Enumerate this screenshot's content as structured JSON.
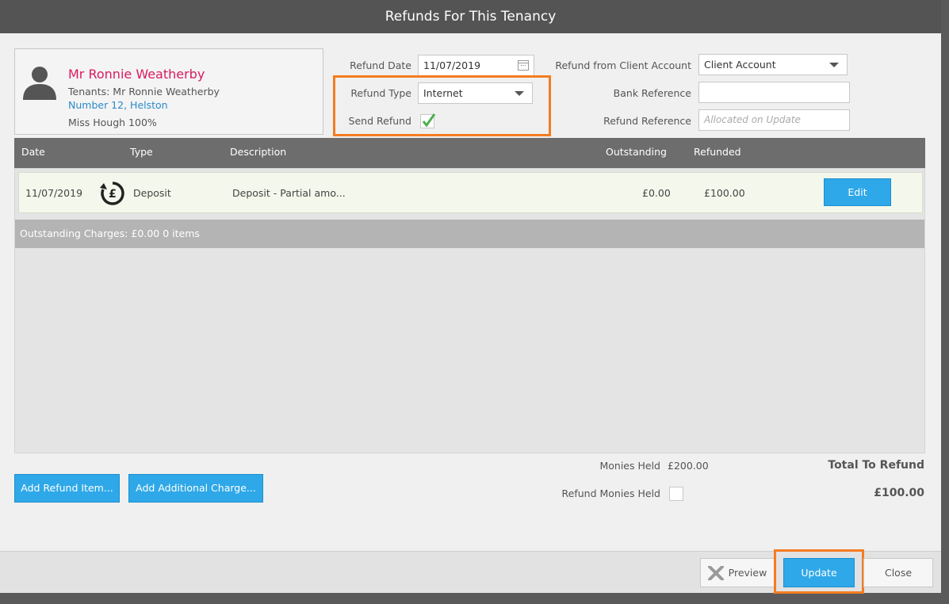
{
  "dialog": {
    "title": "Refunds For This Tenancy"
  },
  "tenant": {
    "name": "Mr Ronnie Weatherby",
    "tenants_line": "Tenants: Mr Ronnie Weatherby",
    "property": "Number 12, Helston",
    "ownership": "Miss Hough 100%"
  },
  "form": {
    "refund_date_label": "Refund Date",
    "refund_date_value": "11/07/2019",
    "refund_type_label": "Refund Type",
    "refund_type_value": "Internet",
    "send_refund_label": "Send Refund",
    "send_refund_checked": true,
    "client_account_label": "Refund from Client Account",
    "client_account_value": "Client Account",
    "bank_reference_label": "Bank Reference",
    "bank_reference_value": "",
    "refund_reference_label": "Refund Reference",
    "refund_reference_placeholder": "Allocated on Update"
  },
  "grid": {
    "columns": [
      "Date",
      "Type",
      "Description",
      "Outstanding",
      "Refunded"
    ],
    "rows": [
      {
        "date": "11/07/2019",
        "type": "Deposit",
        "description": "Deposit - Partial amo...",
        "outstanding": "£0.00",
        "refunded": "£100.00",
        "action": "Edit"
      }
    ],
    "summary": "Outstanding Charges: £0.00 0 items"
  },
  "footer_info": {
    "monies_held_label": "Monies Held",
    "monies_held_value": "£200.00",
    "refund_monies_held_label": "Refund Monies Held",
    "total_title": "Total To Refund",
    "total_value": "£100.00"
  },
  "actions": {
    "add_refund_item": "Add Refund Item...",
    "add_additional_charge": "Add Additional Charge...",
    "preview": "Preview",
    "update": "Update",
    "close": "Close"
  },
  "colors": {
    "accent": "#2ea8e8",
    "highlight": "#f47c20",
    "tenant_name": "#d81b60",
    "link": "#2a8ac9"
  }
}
